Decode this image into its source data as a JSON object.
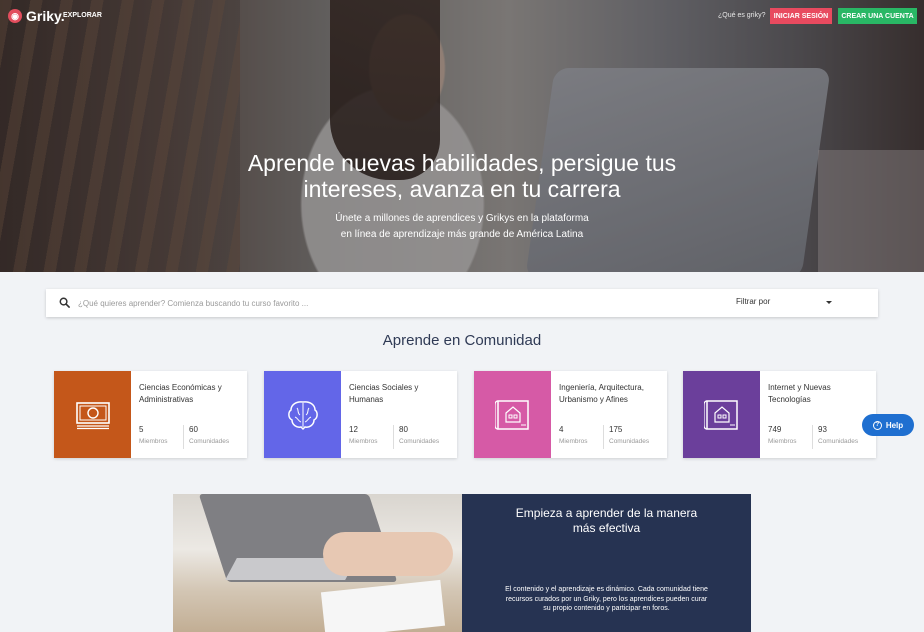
{
  "header": {
    "logo_text": "Griky.",
    "explore_label": "EXPLORAR",
    "what_is_label": "¿Qué es griky?",
    "login_label": "INICIAR SESIÓN",
    "signup_label": "CREAR UNA CUENTA"
  },
  "hero": {
    "title_line1": "Aprende nuevas habilidades, persigue tus",
    "title_line2": "intereses, avanza en tu carrera",
    "subtitle_line1": "Únete a millones de aprendices y Grikys en la plataforma",
    "subtitle_line2": "en línea de aprendizaje más grande de América Latina"
  },
  "search": {
    "placeholder": "¿Qué quieres aprender? Comienza buscando tu curso favorito ...",
    "filter_label": "Filtrar por"
  },
  "community": {
    "title": "Aprende en Comunidad",
    "cards": [
      {
        "name": "Ciencias Económicas y Administrativas",
        "members": "5",
        "members_label": "Miembros",
        "communities": "60",
        "communities_label": "Comunidades",
        "color": "#c4571a",
        "icon": "money-icon"
      },
      {
        "name": "Ciencias Sociales y Humanas",
        "members": "12",
        "members_label": "Miembros",
        "communities": "80",
        "communities_label": "Comunidades",
        "color": "#6366e8",
        "icon": "brain-icon"
      },
      {
        "name": "Ingeniería, Arquitectura, Urbanismo y Afines",
        "members": "4",
        "members_label": "Miembros",
        "communities": "175",
        "communities_label": "Comunidades",
        "color": "#d65aa6",
        "icon": "blueprint-icon"
      },
      {
        "name": "Internet y Nuevas Tecnologías",
        "members": "749",
        "members_label": "Miembros",
        "communities": "93",
        "communities_label": "Comunidades",
        "color": "#6b3f9b",
        "icon": "blueprint-icon"
      }
    ]
  },
  "help": {
    "label": "Help"
  },
  "feature": {
    "title_line1": "Empieza a aprender de la manera",
    "title_line2": "más efectiva",
    "text": "El contenido y el aprendizaje es dinámico. Cada comunidad tiene recursos curados por un Griky, pero los aprendices pueden curar su propio contenido y participar en foros."
  }
}
